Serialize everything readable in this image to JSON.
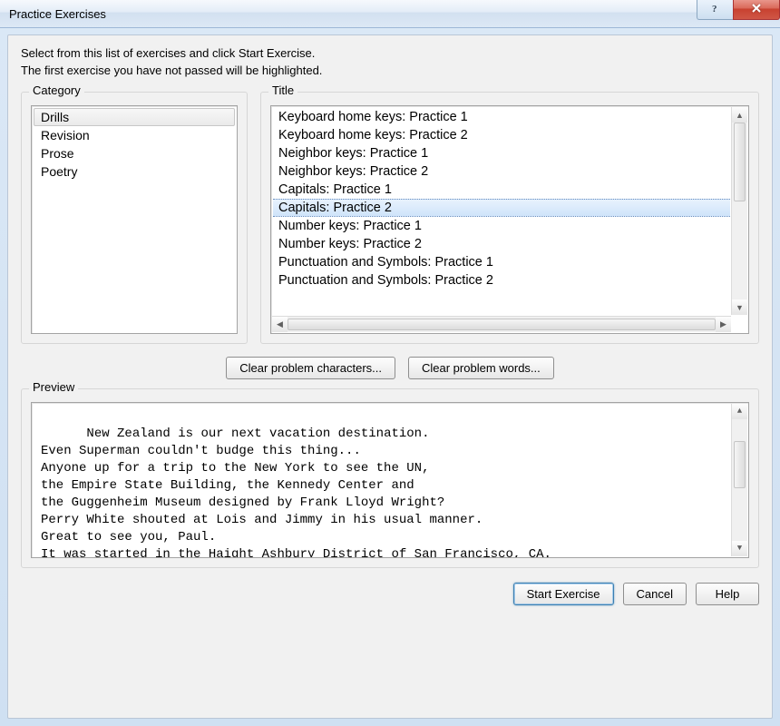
{
  "window": {
    "title": "Practice Exercises"
  },
  "intro": {
    "line1": "Select from this list of exercises and click Start Exercise.",
    "line2": "The first exercise you have not passed will be highlighted."
  },
  "labels": {
    "category": "Category",
    "title": "Title",
    "preview": "Preview"
  },
  "category": {
    "items": [
      {
        "label": "Drills",
        "selected": true
      },
      {
        "label": "Revision",
        "selected": false
      },
      {
        "label": "Prose",
        "selected": false
      },
      {
        "label": "Poetry",
        "selected": false
      }
    ]
  },
  "titles": {
    "items": [
      {
        "label": "Keyboard home keys: Practice 1",
        "selected": false
      },
      {
        "label": "Keyboard home keys: Practice 2",
        "selected": false
      },
      {
        "label": "Neighbor keys: Practice 1",
        "selected": false
      },
      {
        "label": "Neighbor keys: Practice 2",
        "selected": false
      },
      {
        "label": "Capitals: Practice 1",
        "selected": false
      },
      {
        "label": "Capitals: Practice 2",
        "selected": true
      },
      {
        "label": "Number keys: Practice 1",
        "selected": false
      },
      {
        "label": "Number keys: Practice 2",
        "selected": false
      },
      {
        "label": "Punctuation and Symbols: Practice 1",
        "selected": false
      },
      {
        "label": "Punctuation and Symbols: Practice 2",
        "selected": false
      }
    ]
  },
  "buttons": {
    "clear_chars": "Clear problem characters...",
    "clear_words": "Clear problem words...",
    "start": "Start Exercise",
    "cancel": "Cancel",
    "help": "Help"
  },
  "preview": {
    "text": "New Zealand is our next vacation destination.\nEven Superman couldn't budge this thing...\nAnyone up for a trip to the New York to see the UN,\nthe Empire State Building, the Kennedy Center and\nthe Guggenheim Museum designed by Frank Lloyd Wright?\nPerry White shouted at Lois and Jimmy in his usual manner.\nGreat to see you, Paul.\nIt was started in the Haight Ashbury District of San Francisco, CA."
  }
}
